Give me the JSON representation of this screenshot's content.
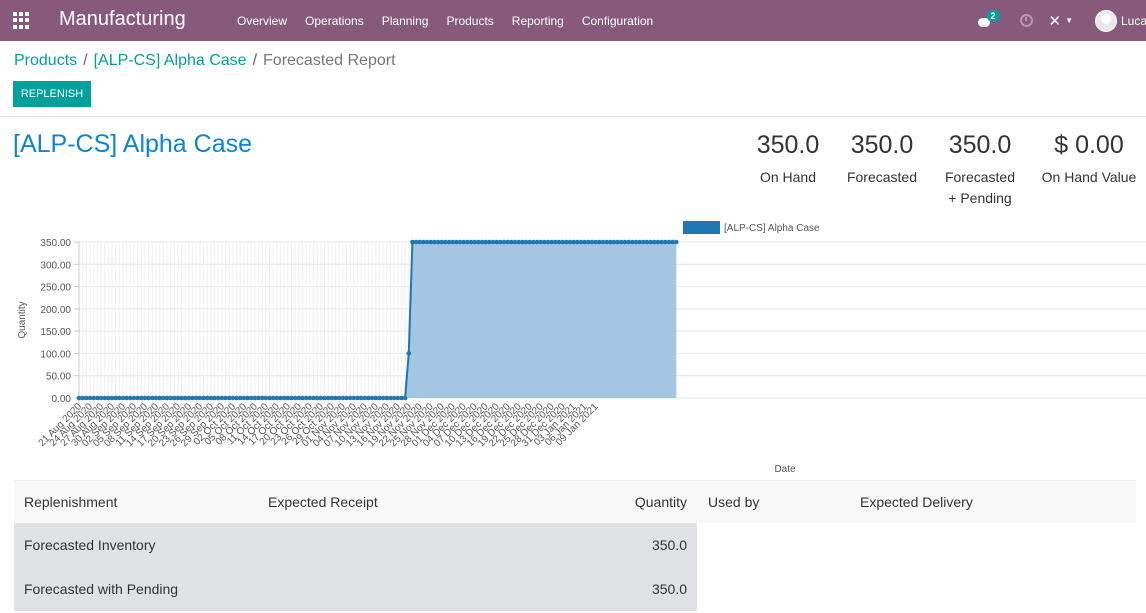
{
  "navbar": {
    "brand": "Manufacturing",
    "menu": [
      "Overview",
      "Operations",
      "Planning",
      "Products",
      "Reporting",
      "Configuration"
    ],
    "chat_badge": "2",
    "user": "Luca"
  },
  "breadcrumb": {
    "items": [
      "Products",
      "[ALP-CS] Alpha Case"
    ],
    "active": "Forecasted Report"
  },
  "toolbar": {
    "replenish_label": "REPLENISH"
  },
  "product": {
    "title": "[ALP-CS] Alpha Case"
  },
  "stats": [
    {
      "value": "350.0",
      "label": "On Hand",
      "label2": ""
    },
    {
      "value": "350.0",
      "label": "Forecasted",
      "label2": ""
    },
    {
      "value": "350.0",
      "label": "Forecasted",
      "label2": "+ Pending"
    },
    {
      "value": "$ 0.00",
      "label": "On Hand Value",
      "label2": ""
    }
  ],
  "chart_data": {
    "type": "area",
    "legend": "[ALP-CS] Alpha Case",
    "xlabel": "Date",
    "ylabel": "Quantity",
    "ylim": [
      0,
      350
    ],
    "yticks": [
      "0.00",
      "50.00",
      "100.00",
      "150.00",
      "200.00",
      "250.00",
      "300.00",
      "350.00"
    ],
    "x_start": "2020-08-21",
    "x_ticks": [
      "21 Aug 2020",
      "24 Aug 2020",
      "27 Aug 2020",
      "30 Aug 2020",
      "02 Sep 2020",
      "05 Sep 2020",
      "08 Sep 2020",
      "11 Sep 2020",
      "14 Sep 2020",
      "17 Sep 2020",
      "20 Sep 2020",
      "23 Sep 2020",
      "26 Sep 2020",
      "29 Sep 2020",
      "02 Oct 2020",
      "05 Oct 2020",
      "08 Oct 2020",
      "11 Oct 2020",
      "14 Oct 2020",
      "17 Oct 2020",
      "20 Oct 2020",
      "23 Oct 2020",
      "26 Oct 2020",
      "29 Oct 2020",
      "01 Nov 2020",
      "04 Nov 2020",
      "07 Nov 2020",
      "10 Nov 2020",
      "13 Nov 2020",
      "16 Nov 2020",
      "19 Nov 2020",
      "22 Nov 2020",
      "25 Nov 2020",
      "28 Nov 2020",
      "01 Dec 2020",
      "04 Dec 2020",
      "07 Dec 2020",
      "10 Dec 2020",
      "13 Dec 2020",
      "16 Dec 2020",
      "19 Dec 2020",
      "22 Dec 2020",
      "25 Dec 2020",
      "28 Dec 2020",
      "31 Dec 2020",
      "03 Jan 2021",
      "06 Jan 2021",
      "09 Jan 2021"
    ],
    "values": [
      0,
      0,
      0,
      0,
      0,
      0,
      0,
      0,
      0,
      0,
      0,
      0,
      0,
      0,
      0,
      0,
      0,
      0,
      0,
      0,
      0,
      0,
      0,
      0,
      0,
      0,
      0,
      0,
      0,
      0,
      0,
      0,
      0,
      0,
      0,
      0,
      0,
      0,
      0,
      0,
      0,
      0,
      0,
      0,
      0,
      0,
      0,
      0,
      0,
      0,
      0,
      0,
      0,
      0,
      0,
      0,
      0,
      0,
      0,
      0,
      0,
      0,
      0,
      0,
      0,
      0,
      0,
      0,
      0,
      0,
      0,
      0,
      0,
      0,
      0,
      0,
      0,
      0,
      0,
      0,
      0,
      0,
      0,
      0,
      0,
      0,
      0,
      0,
      0,
      0,
      100,
      350,
      350,
      350,
      350,
      350,
      350,
      350,
      350,
      350,
      350,
      350,
      350,
      350,
      350,
      350,
      350,
      350,
      350,
      350,
      350,
      350,
      350,
      350,
      350,
      350,
      350,
      350,
      350,
      350,
      350,
      350,
      350,
      350,
      350,
      350,
      350,
      350,
      350,
      350,
      350,
      350,
      350,
      350,
      350,
      350,
      350,
      350,
      350,
      350,
      350,
      350,
      350,
      350,
      350,
      350,
      350,
      350,
      350,
      350,
      350,
      350,
      350,
      350,
      350,
      350,
      350,
      350,
      350,
      350,
      350,
      350,
      350,
      350
    ],
    "series_color": "#1f77b4",
    "fill_color": "#9ec3e0"
  },
  "table": {
    "headers": [
      "Replenishment",
      "Expected Receipt",
      "Quantity",
      "Used by",
      "Expected Delivery"
    ],
    "rows": [
      {
        "label": "Forecasted Inventory",
        "quantity": "350.0"
      },
      {
        "label": "Forecasted with Pending",
        "quantity": "350.0"
      }
    ]
  }
}
